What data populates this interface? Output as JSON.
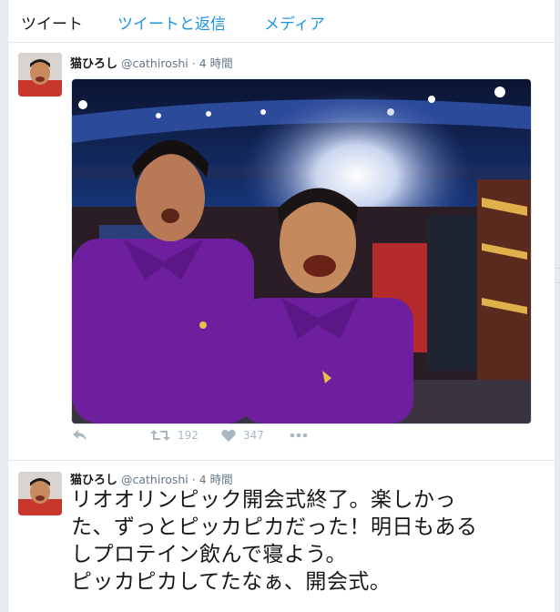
{
  "tabs": [
    {
      "label": "ツイート",
      "active": true
    },
    {
      "label": "ツイートと返信",
      "active": false
    },
    {
      "label": "メディア",
      "active": false
    }
  ],
  "tweets": [
    {
      "author_name": "猫ひろし",
      "handle": "@cathiroshi",
      "separator": "·",
      "time": "4 時間",
      "retweet_count": "192",
      "like_count": "347"
    },
    {
      "author_name": "猫ひろし",
      "handle": "@cathiroshi",
      "separator": "·",
      "time": "4 時間",
      "text_lines": [
        "リオオリンピック開会式終了。楽しかっ",
        "た、ずっとピッカピカだった！明日もある",
        "しプロテイン飲んで寝よう。",
        "ピッカピカしてたなぁ、開会式。"
      ]
    }
  ],
  "colors": {
    "link": "#1b95e0",
    "text": "#14171a",
    "muted": "#657786",
    "icon": "#aab8c2",
    "shirt": "#6d1f9e"
  }
}
